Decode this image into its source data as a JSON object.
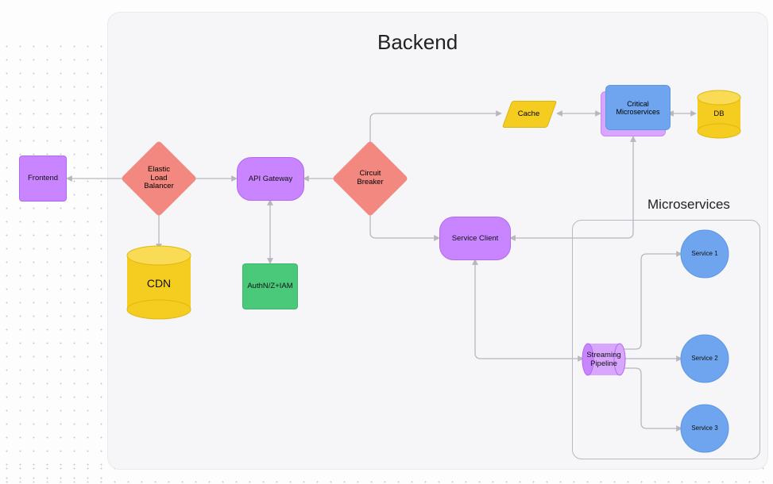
{
  "diagram": {
    "title": "Backend",
    "microservices_title": "Microservices",
    "nodes": {
      "frontend": {
        "label": "Frontend"
      },
      "elb": {
        "label": "Elastic\nLoad\nBalancer"
      },
      "cdn": {
        "label": "CDN"
      },
      "api_gateway": {
        "label": "API Gateway"
      },
      "auth": {
        "label": "AuthN/Z+IAM"
      },
      "circuit": {
        "label": "Circuit\nBreaker"
      },
      "cache": {
        "label": "Cache"
      },
      "svc_client": {
        "label": "Service Client"
      },
      "critical": {
        "label": "Critical\nMicroservices"
      },
      "db": {
        "label": "DB"
      },
      "stream": {
        "label": "Streaming\nPipeline"
      },
      "svc1": {
        "label": "Service 1"
      },
      "svc2": {
        "label": "Service 2"
      },
      "svc3": {
        "label": "Service 3"
      }
    },
    "edges": [
      [
        "frontend",
        "elb",
        "bi"
      ],
      [
        "elb",
        "api_gateway",
        "bi"
      ],
      [
        "elb",
        "cdn",
        "bi"
      ],
      [
        "api_gateway",
        "auth",
        "bi"
      ],
      [
        "api_gateway",
        "circuit",
        "bi"
      ],
      [
        "circuit",
        "cache",
        "bi"
      ],
      [
        "circuit",
        "svc_client",
        "bi"
      ],
      [
        "cache",
        "critical",
        "bi"
      ],
      [
        "svc_client",
        "critical",
        "bi"
      ],
      [
        "svc_client",
        "stream",
        "bi"
      ],
      [
        "critical",
        "db",
        "bi"
      ],
      [
        "stream",
        "svc1",
        "uni"
      ],
      [
        "stream",
        "svc2",
        "uni"
      ],
      [
        "stream",
        "svc3",
        "uni"
      ]
    ],
    "colors": {
      "purple": "#c985ff",
      "purple_light": "#d7a7ff",
      "green": "#4bc97a",
      "red": "#f2887f",
      "blue": "#6ea5ee",
      "yellow": "#f5cc20",
      "link": "#b7b7bf"
    }
  }
}
